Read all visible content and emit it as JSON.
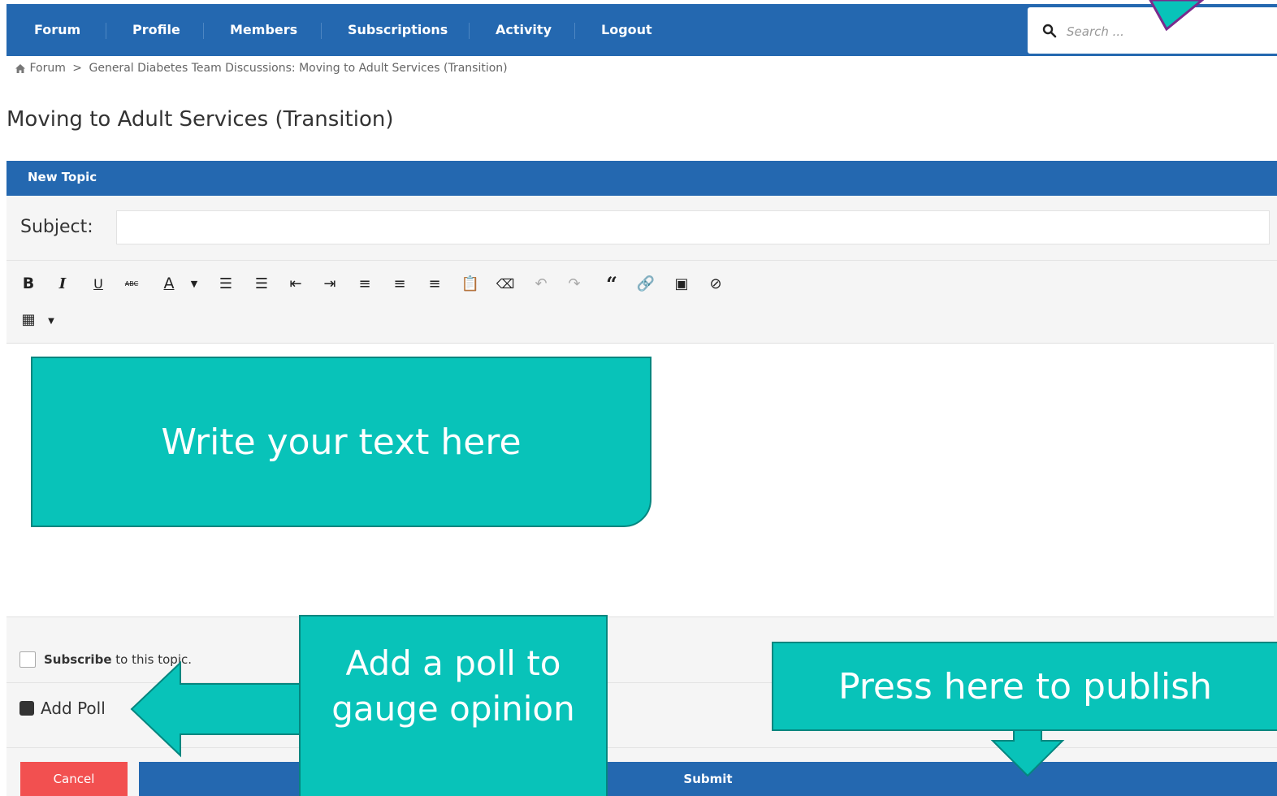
{
  "nav": {
    "items": [
      "Forum",
      "Profile",
      "Members",
      "Subscriptions",
      "Activity",
      "Logout"
    ],
    "search_placeholder": "Search ..."
  },
  "breadcrumb": {
    "home": "Forum",
    "separator": ">",
    "current": "General Diabetes Team Discussions: Moving to Adult Services (Transition)"
  },
  "page_title": "Moving to Adult Services (Transition)",
  "form": {
    "header": "New Topic",
    "subject_label": "Subject:",
    "subject_value": "",
    "toolbar_icons": [
      "bold-icon",
      "italic-icon",
      "underline-icon",
      "strikethrough-icon",
      "text-color-icon",
      "color-dropdown-icon",
      "bullet-list-icon",
      "numbered-list-icon",
      "outdent-icon",
      "indent-icon",
      "align-left-icon",
      "align-center-icon",
      "align-right-icon",
      "paste-icon",
      "eraser-icon",
      "undo-icon",
      "redo-icon",
      "quote-icon",
      "link-icon",
      "image-icon",
      "hidden-icon",
      "table-icon",
      "table-dropdown-icon"
    ],
    "toolbar_glyphs": {
      "bold": "B",
      "italic": "I",
      "underline": "U",
      "strike": "ABC",
      "color": "A"
    },
    "subscribe_strong": "Subscribe",
    "subscribe_rest": " to this topic.",
    "add_poll": "Add Poll",
    "cancel": "Cancel",
    "submit": "Submit"
  },
  "callouts": {
    "text": "Write your text here",
    "poll": "Add a poll to gauge opinion",
    "publish": "Press here to publish"
  },
  "colors": {
    "nav_blue": "#2468b0",
    "callout_teal": "#08c3b9",
    "cancel_red": "#f25050",
    "arrow_purple": "#7b2a8c"
  }
}
